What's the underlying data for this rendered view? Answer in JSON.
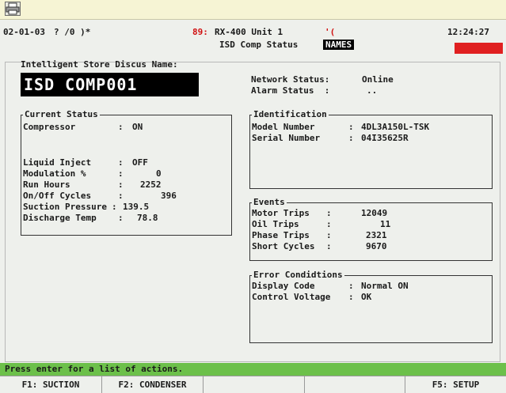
{
  "header": {
    "date": "02-01-03",
    "flags": "? /0 )*",
    "controller_id": "89:",
    "controller": "RX-400 Unit 1",
    "signal": "'(",
    "screen_title": "ISD Comp Status",
    "names_badge": "NAMES",
    "clock": "12:24:27"
  },
  "store": {
    "label": "Intelligent Store Discus Name:",
    "name": "ISD COMP001"
  },
  "network": {
    "status_label": "Network Status:",
    "status_value": "Online",
    "alarm_label": "Alarm Status  :",
    "alarm_value": ".."
  },
  "current_status": {
    "title": "Current Status",
    "rows": [
      {
        "label": "Compressor",
        "sep": ":",
        "value": "ON"
      },
      {
        "label": "Liquid Inject",
        "sep": ":",
        "value": "OFF"
      },
      {
        "label": "Modulation %",
        "sep": ":",
        "value": "0"
      },
      {
        "label": "Run Hours",
        "sep": ":",
        "value": "2252"
      },
      {
        "label": "On/Off Cycles",
        "sep": ":",
        "value": "396"
      },
      {
        "label": "Suction Pressure",
        "sep": ":",
        "value": "139.5"
      },
      {
        "label": "Discharge Temp",
        "sep": ":",
        "value": "78.8"
      }
    ]
  },
  "identification": {
    "title": "Identification",
    "rows": [
      {
        "label": "Model Number",
        "sep": ":",
        "value": "4DL3A150L-TSK"
      },
      {
        "label": "Serial Number",
        "sep": ":",
        "value": "04I35625R"
      }
    ]
  },
  "events": {
    "title": "Events",
    "rows": [
      {
        "label": "Motor Trips",
        "sep": ":",
        "value": "12049"
      },
      {
        "label": "Oil Trips",
        "sep": ":",
        "value": "11"
      },
      {
        "label": "Phase Trips",
        "sep": ":",
        "value": "2321"
      },
      {
        "label": "Short Cycles",
        "sep": ":",
        "value": "9670"
      }
    ]
  },
  "error_conditions": {
    "title": "Error Condidtions",
    "rows": [
      {
        "label": "Display Code",
        "sep": ":",
        "value": "Normal ON"
      },
      {
        "label": "Control Voltage",
        "sep": ":",
        "value": "OK"
      }
    ]
  },
  "statusbar": {
    "message": "Press enter for a list of actions."
  },
  "function_keys": [
    {
      "label": "F1: SUCTION"
    },
    {
      "label": "F2: CONDENSER"
    },
    {
      "label": ""
    },
    {
      "label": ""
    },
    {
      "label": "F5: SETUP"
    }
  ],
  "colors": {
    "statusbar": "#6cc04a",
    "alarm_block": "#e02020",
    "toolbar": "#f6f4d4"
  },
  "icons": {
    "print": "printer-icon"
  }
}
